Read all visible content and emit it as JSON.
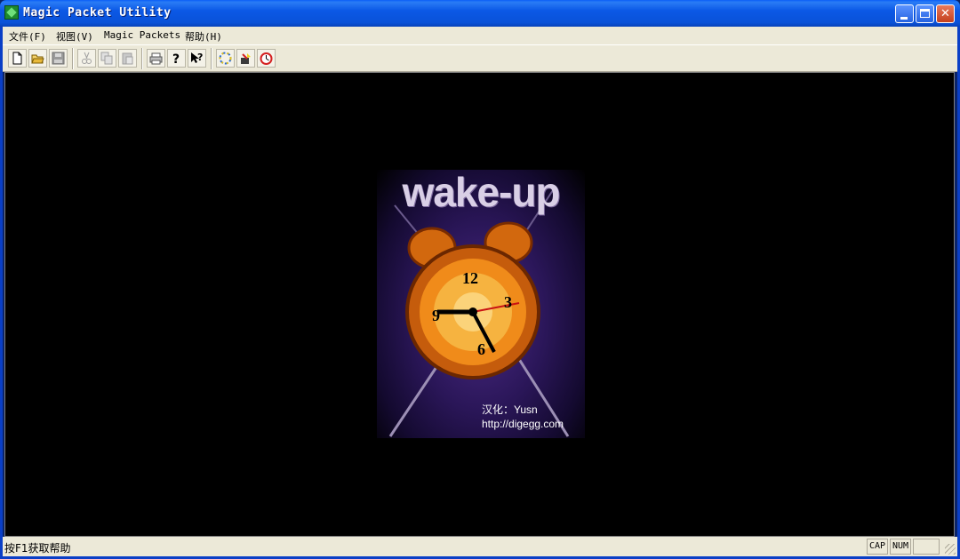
{
  "window": {
    "title": "Magic Packet Utility",
    "icon": "app-icon"
  },
  "menu": [
    {
      "label": "文件(F)"
    },
    {
      "label": "视图(V)"
    },
    {
      "label": "Magic Packets"
    },
    {
      "label": "帮助(H)"
    }
  ],
  "toolbar": {
    "buttons": [
      "new-icon",
      "open-icon",
      "save-icon",
      "cut-icon",
      "copy-icon",
      "paste-icon",
      "print-icon",
      "help-icon",
      "context-help-icon",
      "wake-icon",
      "send-icon",
      "clock-icon"
    ]
  },
  "splash": {
    "title": "wake-up",
    "credit_line1": "汉化：Yusn",
    "credit_line2": "http://digegg.com"
  },
  "statusbar": {
    "text": "按F1获取帮助",
    "cap": "CAP",
    "num": "NUM"
  }
}
